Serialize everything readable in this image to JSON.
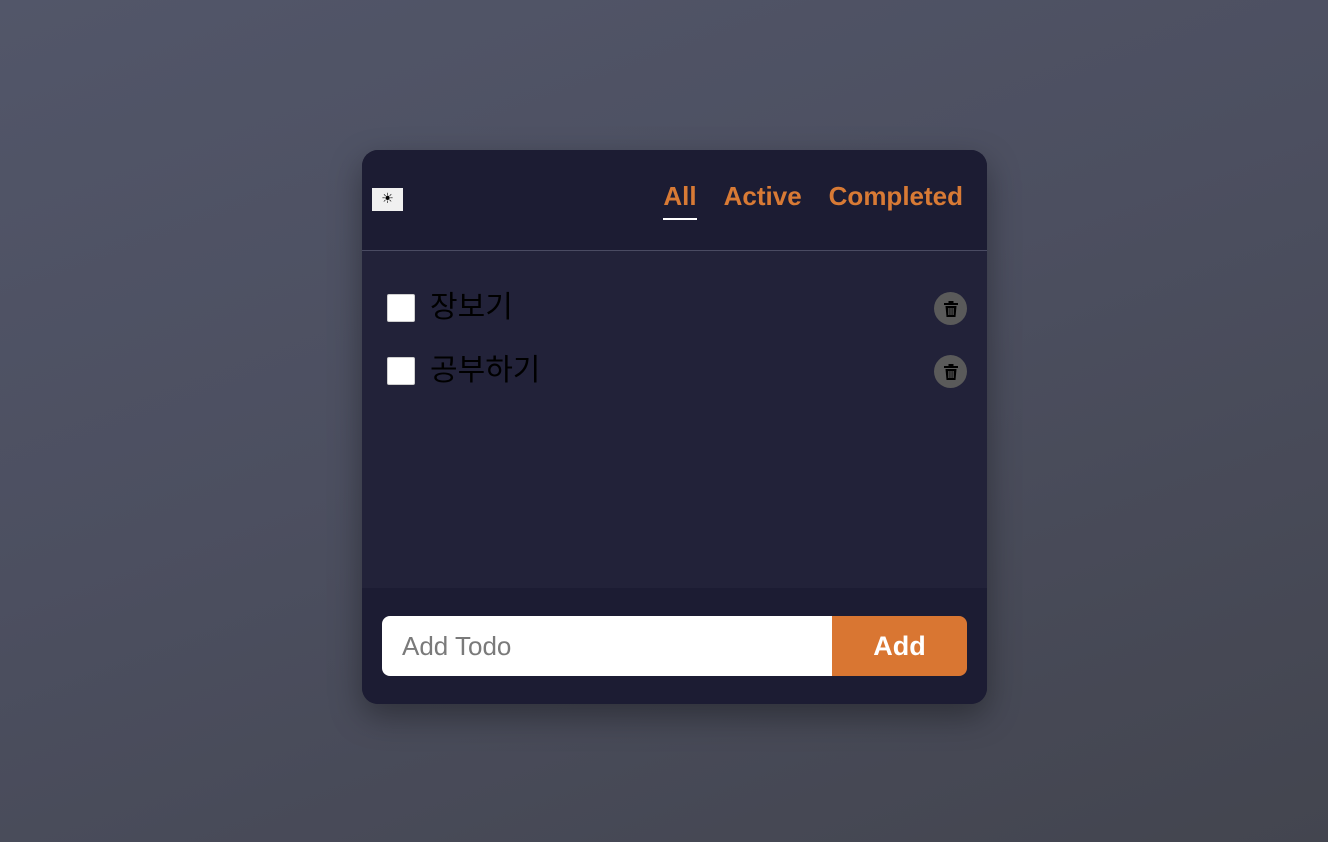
{
  "header": {
    "theme_toggle": {
      "icon": "sun-icon",
      "glyph": "☀"
    },
    "tabs": [
      {
        "label": "All",
        "selected": true
      },
      {
        "label": "Active",
        "selected": false
      },
      {
        "label": "Completed",
        "selected": false
      }
    ]
  },
  "todos": [
    {
      "text": "장보기",
      "completed": false
    },
    {
      "text": "공부하기",
      "completed": false
    }
  ],
  "form": {
    "placeholder": "Add Todo",
    "value": "",
    "add_label": "Add"
  },
  "colors": {
    "accent": "#d87a35",
    "card_background": "#1c1c33",
    "list_background": "#222239",
    "delete_button": "#5a5a5a"
  }
}
